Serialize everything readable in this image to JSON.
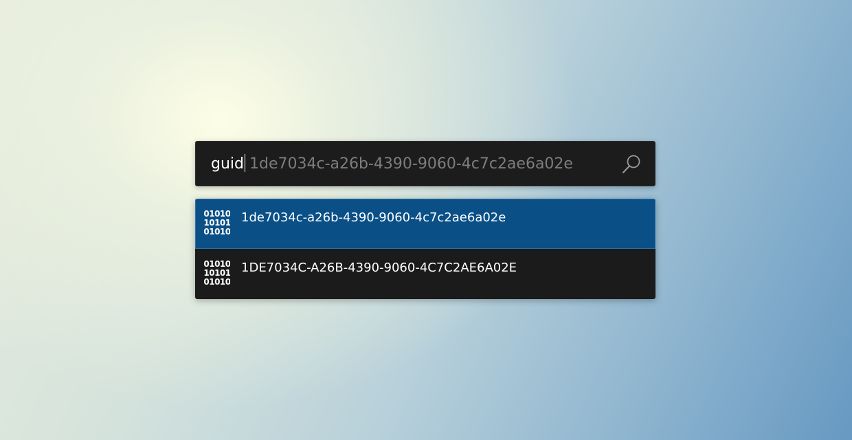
{
  "search": {
    "typed_text": "guid",
    "suggestion_text": "1de7034c-a26b-4390-9060-4c7c2ae6a02e",
    "button_icon": "search-icon"
  },
  "results": [
    {
      "label": "1de7034c-a26b-4390-9060-4c7c2ae6a02e",
      "icon": "binary-icon",
      "selected": true
    },
    {
      "label": "1DE7034C-A26B-4390-9060-4C7C2AE6A02E",
      "icon": "binary-icon",
      "selected": false
    }
  ],
  "colors": {
    "selected_bg": "#0a5087",
    "panel_bg": "#1b1b1b",
    "suggestion_text": "#7d7d7d"
  }
}
